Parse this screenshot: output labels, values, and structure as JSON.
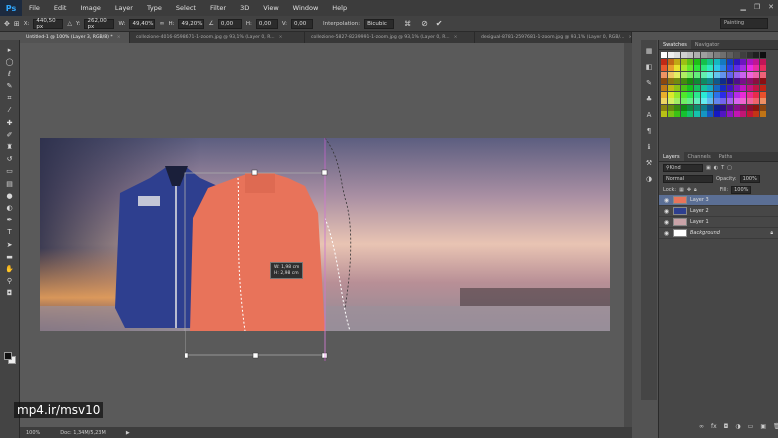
{
  "app": {
    "logo": "Ps"
  },
  "menu": [
    "File",
    "Edit",
    "Image",
    "Layer",
    "Type",
    "Select",
    "Filter",
    "3D",
    "View",
    "Window",
    "Help"
  ],
  "options": {
    "x_label": "X:",
    "x_value": "440,50 px",
    "y_label": "Y:",
    "y_value": "262,00 px",
    "w_label": "W:",
    "w_value": "49,40%",
    "h_label": "H:",
    "h_value": "49,20%",
    "angle_value": "0,00",
    "h_skew_label": "H:",
    "h_skew_value": "0,00",
    "v_skew_label": "V:",
    "v_skew_value": "0,00",
    "interp_label": "Interpolation:",
    "interp_value": "Bicubic",
    "workspace": "Painting"
  },
  "tabs": [
    {
      "label": "Untitled-1 @ 100% (Layer 3, RGB/8) *",
      "active": true
    },
    {
      "label": "collezione-4016-8598671-1-zoom.jpg @ 93,1% (Layer 0, R...",
      "active": false
    },
    {
      "label": "collezione-5827-8239991-1-zoom.jpg @ 93,1% (Layer 0, R...",
      "active": false
    },
    {
      "label": "desigual-8781-2597681-1-zoom.jpg @ 93,1% (Layer 0, RGB/...",
      "active": false
    }
  ],
  "status": {
    "zoom": "100%",
    "doc": "Doc: 1,34M/5,23M"
  },
  "transform_tip": {
    "line1": "W: 1,98 cm",
    "line2": "H: 2,98 cm"
  },
  "panels": {
    "swatch_tabs": [
      "Swatches",
      "Navigator"
    ],
    "layer_tabs": [
      "Layers",
      "Channels",
      "Paths"
    ],
    "kind": "Kind",
    "blend_mode": "Normal",
    "opacity_label": "Opacity:",
    "opacity_value": "100%",
    "lock_label": "Lock:",
    "fill_label": "Fill:",
    "fill_value": "100%",
    "layers": [
      {
        "name": "Layer 3",
        "selected": true
      },
      {
        "name": "Layer 2",
        "selected": false
      },
      {
        "name": "Layer 1",
        "selected": false
      },
      {
        "name": "Background",
        "selected": false
      }
    ]
  },
  "watermark": "mp4.ir/msv10",
  "colors": {
    "accent": "#31a8ff",
    "selection": "#5b6f95",
    "sweater": "#e8735a",
    "jacket": "#2e3f8f"
  }
}
